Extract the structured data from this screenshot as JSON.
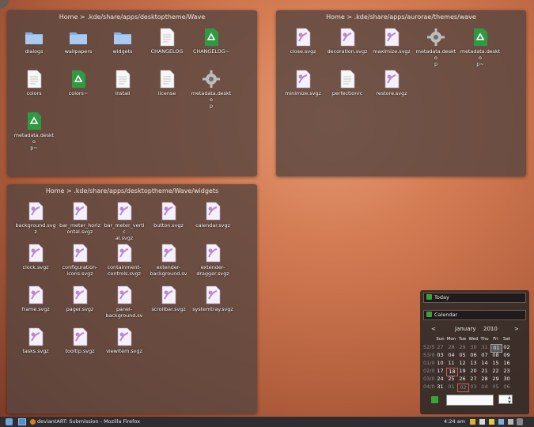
{
  "panels": [
    {
      "name": "wave-folder",
      "title": "Home > .kde/share/apps/desktoptheme/Wave",
      "items": [
        {
          "label": "dialogs",
          "icon": "folder-icon"
        },
        {
          "label": "wallpapers",
          "icon": "folder-icon"
        },
        {
          "label": "widgets",
          "icon": "folder-icon"
        },
        {
          "label": "CHANGELOG",
          "icon": "text-file-icon"
        },
        {
          "label": "CHANGELOG~",
          "icon": "recycle-icon"
        },
        {
          "label": "colors",
          "icon": "text-file-icon"
        },
        {
          "label": "colors~",
          "icon": "recycle-icon"
        },
        {
          "label": "install",
          "icon": "text-file-icon"
        },
        {
          "label": "license",
          "icon": "text-file-icon"
        },
        {
          "label": "metadata.deskto\np",
          "icon": "gear-icon"
        },
        {
          "label": "metadata.deskto\np~",
          "icon": "recycle-icon"
        }
      ]
    },
    {
      "name": "aurorae-folder",
      "title": "Home > .kde/share/apps/aurorae/themes/wave",
      "items": [
        {
          "label": "close.svgz",
          "icon": "svg-file-icon"
        },
        {
          "label": "decoration.svgz",
          "icon": "svg-file-icon"
        },
        {
          "label": "maximize.svgz",
          "icon": "svg-file-icon"
        },
        {
          "label": "metadata.deskto\np",
          "icon": "gear-icon"
        },
        {
          "label": "metadata.deskto\np~",
          "icon": "recycle-icon"
        },
        {
          "label": "minimize.svgz",
          "icon": "svg-file-icon"
        },
        {
          "label": "perfectionrc",
          "icon": "text-file-icon"
        },
        {
          "label": "restore.svgz",
          "icon": "svg-file-icon"
        }
      ]
    },
    {
      "name": "widgets-folder",
      "title": "Home > .kde/share/apps/desktoptheme/Wave/widgets",
      "items": [
        {
          "label": "background.svg\nz",
          "icon": "svg-file-icon"
        },
        {
          "label": "bar_meter_horiz\nontal.svgz",
          "icon": "svg-file-icon"
        },
        {
          "label": "bar_meter_vertic\nal.svgz",
          "icon": "svg-file-icon"
        },
        {
          "label": "button.svgz",
          "icon": "svg-file-icon"
        },
        {
          "label": "calendar.svgz",
          "icon": "svg-file-icon"
        },
        {
          "label": "clock.svgz",
          "icon": "svg-file-icon"
        },
        {
          "label": "configuration-\nicons.svgz",
          "icon": "svg-file-icon"
        },
        {
          "label": "containment-\ncontrols.svgz",
          "icon": "svg-file-icon"
        },
        {
          "label": "extender-\nbackground.sv",
          "icon": "svg-file-icon"
        },
        {
          "label": "extender-\ndragger.svgz",
          "icon": "svg-file-icon"
        },
        {
          "label": "frame.svgz",
          "icon": "svg-file-icon"
        },
        {
          "label": "pager.svgz",
          "icon": "svg-file-icon"
        },
        {
          "label": "panel-\nbackground.sv",
          "icon": "svg-file-icon"
        },
        {
          "label": "scrollbar.svgz",
          "icon": "svg-file-icon"
        },
        {
          "label": "systemtray.svgz",
          "icon": "svg-file-icon"
        },
        {
          "label": "tasks.svgz",
          "icon": "svg-file-icon"
        },
        {
          "label": "tooltip.svgz",
          "icon": "svg-file-icon"
        },
        {
          "label": "viewitem.svgz",
          "icon": "svg-file-icon"
        }
      ]
    }
  ],
  "calendar": {
    "today_label": "Today",
    "calendar_label": "Calendar",
    "prev": "<",
    "next": ">",
    "month": "January",
    "year": "2010",
    "weekdays": [
      "Sun",
      "Mon",
      "Tue",
      "Wed",
      "Thu",
      "Fri",
      "Sat"
    ],
    "weeks": [
      "52/5",
      "53/0",
      "01/0",
      "02/0",
      "03/0",
      "04/0"
    ],
    "days": [
      [
        "27",
        "28",
        "29",
        "30",
        "31",
        "01",
        "02"
      ],
      [
        "03",
        "04",
        "05",
        "06",
        "07",
        "08",
        "09"
      ],
      [
        "10",
        "11",
        "12",
        "13",
        "14",
        "15",
        "16"
      ],
      [
        "17",
        "18",
        "19",
        "20",
        "21",
        "22",
        "23"
      ],
      [
        "24",
        "25",
        "26",
        "27",
        "28",
        "29",
        "30"
      ],
      [
        "31",
        "01",
        "02",
        "03",
        "04",
        "05",
        "06"
      ]
    ]
  },
  "taskbar": {
    "task_title": "deviantART: Submission - Mozilla Firefox",
    "clock": "4:24 am"
  },
  "colors": {
    "panel_bg": "#584640",
    "recycle_green": "#2f9a43",
    "folder_blue": "#7fb0e8",
    "svg_purple": "#b98bd0"
  }
}
